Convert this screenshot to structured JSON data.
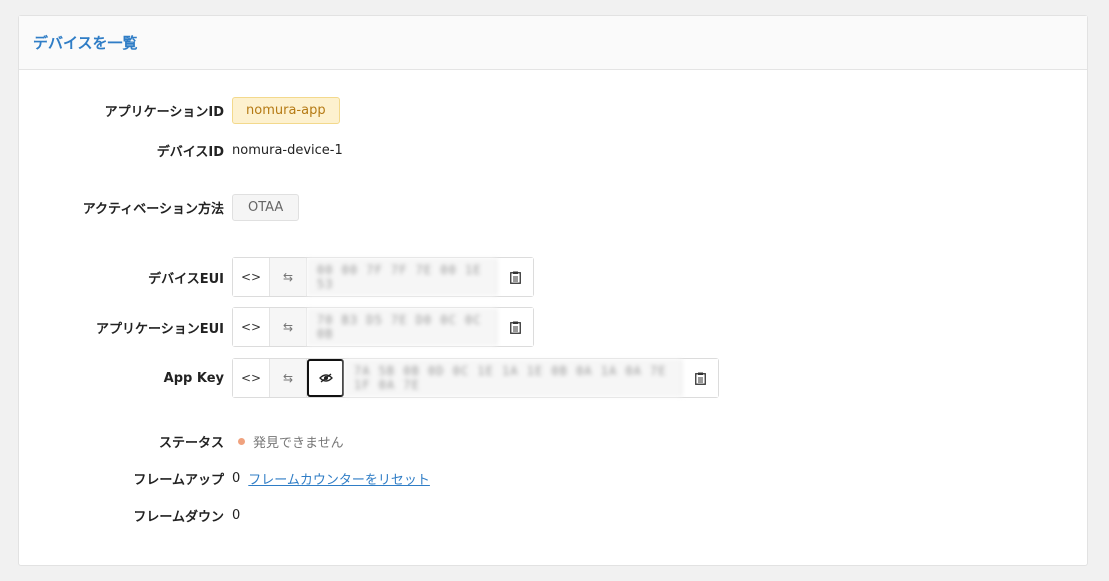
{
  "header": {
    "title": "デバイスを一覧"
  },
  "fields": {
    "app_id": {
      "label": "アプリケーションID",
      "value": "nomura-app"
    },
    "device_id": {
      "label": "デバイスID",
      "value": "nomura-device-1"
    },
    "activation": {
      "label": "アクティベーション方法",
      "value": "OTAA"
    },
    "dev_eui": {
      "label": "デバイスEUI",
      "value": "00 00 7F 7F 7E 00 1E 53"
    },
    "app_eui": {
      "label": "アプリケーションEUI",
      "value": "70 B3 D5 7E D0 0C 0C 0B"
    },
    "app_key": {
      "label": "App Key",
      "value": "7A 5B 0B 0D 0C 1E 1A 1E 0B 0A 1A 0A 7E 1F 0A 7E"
    },
    "status": {
      "label": "ステータス",
      "value": "発見できません",
      "dot_color": "#f0a27e"
    },
    "frames_up": {
      "label": "フレームアップ",
      "value": "0",
      "reset_link": "フレームカウンターをリセット"
    },
    "frames_down": {
      "label": "フレームダウン",
      "value": "0"
    }
  },
  "icons": {
    "format": "<>",
    "swap": "⇆",
    "copy": "clipboard-icon",
    "hide": "eye-slash-icon"
  },
  "colors": {
    "accent": "#2f7dc6",
    "app_tag_bg": "#fdf1cf",
    "app_tag_text": "#b57a14"
  }
}
